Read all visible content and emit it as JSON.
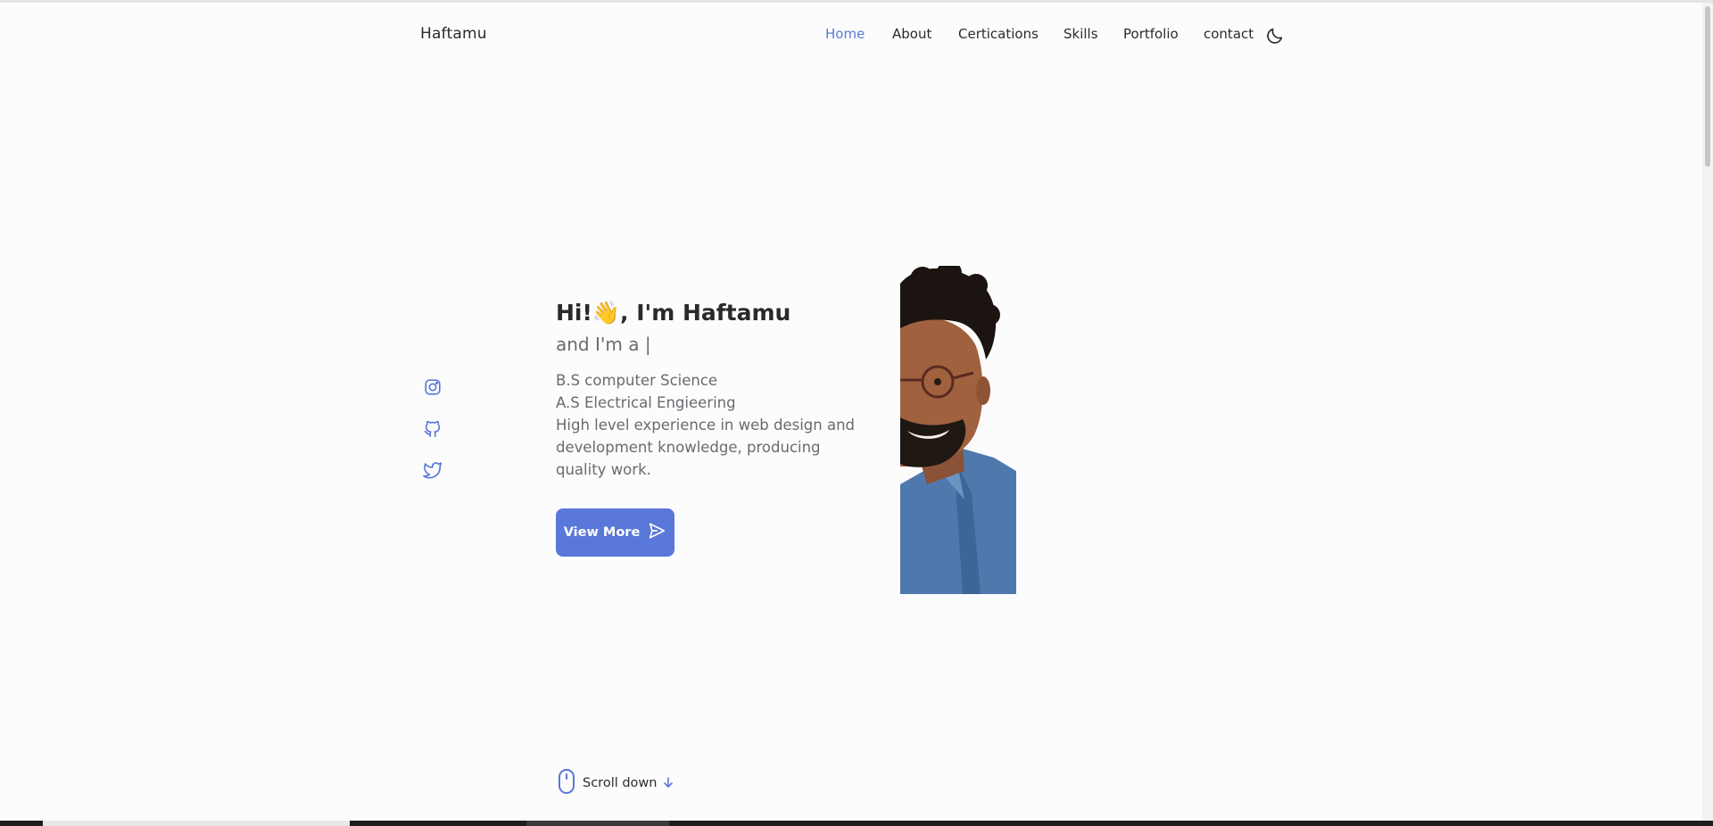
{
  "header": {
    "logo": "Haftamu",
    "nav": [
      {
        "label": "Home",
        "active": true
      },
      {
        "label": "About",
        "active": false
      },
      {
        "label": "Certications",
        "active": false
      },
      {
        "label": "Skills",
        "active": false
      },
      {
        "label": "Portfolio",
        "active": false
      },
      {
        "label": "contact",
        "active": false
      }
    ],
    "theme_toggle_icon": "moon-icon"
  },
  "social": [
    {
      "icon": "instagram-icon"
    },
    {
      "icon": "github-icon"
    },
    {
      "icon": "twitter-icon"
    }
  ],
  "hero": {
    "title_prefix": "Hi!",
    "title_emoji": "👋",
    "title_suffix": ", I'm Haftamu",
    "subtitle": "and I'm a |",
    "description_lines": [
      "B.S computer Science",
      "A.S Electrical Engieering",
      "High level experience in web design and",
      "development knowledge, producing",
      "quality work."
    ],
    "button_label": "View More",
    "button_icon": "send-icon",
    "portrait_icon": "portrait-photo"
  },
  "scroll": {
    "label": "Scroll down",
    "icon": "mouse-icon",
    "arrow_icon": "arrow-down-icon"
  },
  "colors": {
    "accent": "#5a78d9",
    "text": "#2b2b2b",
    "muted": "#6a6a70",
    "background": "#fcfcfd"
  }
}
